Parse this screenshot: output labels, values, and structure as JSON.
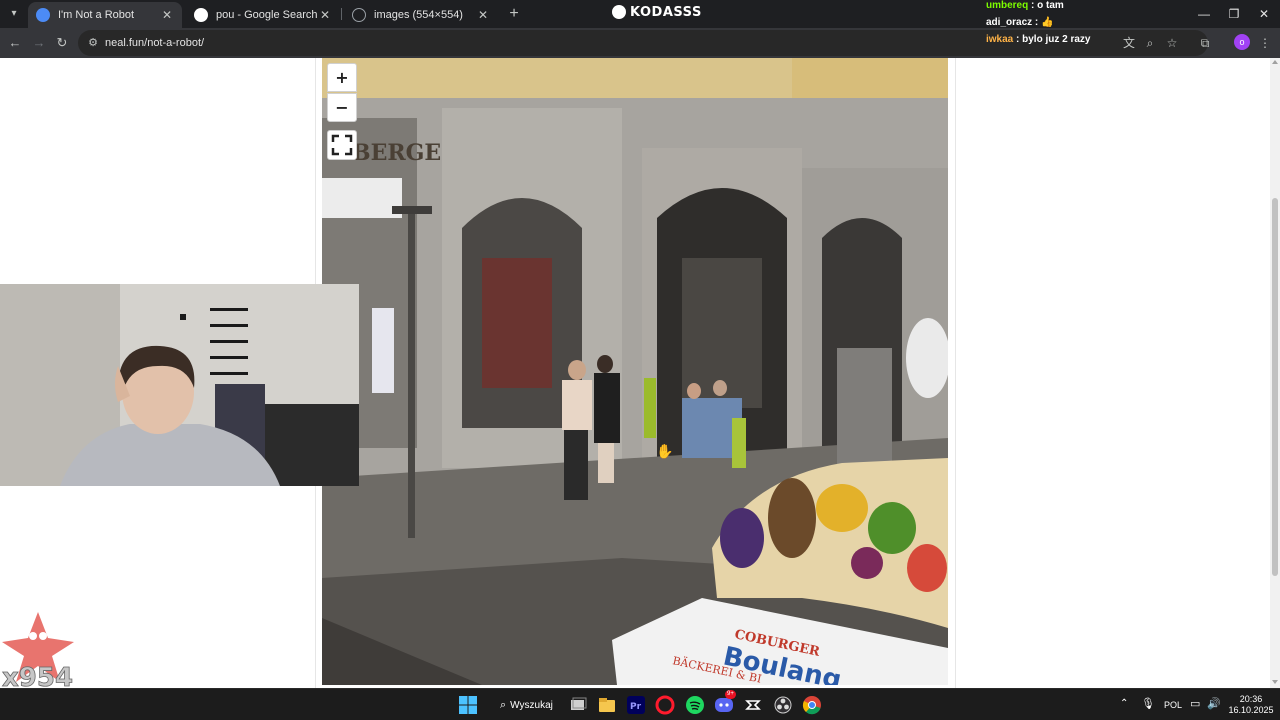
{
  "browser": {
    "tabs": [
      {
        "title": "I'm Not a Robot",
        "active": true,
        "favicon_color": "#4c8bf5"
      },
      {
        "title": "pou - Google Search",
        "active": false,
        "favicon_color": "#ffffff"
      },
      {
        "title": "images (554×554)",
        "active": false,
        "favicon_color": "#9aa0a6"
      }
    ],
    "url": "neal.fun/not-a-robot/",
    "overlay_title": "KODASSS"
  },
  "chat": [
    {
      "user": "umbereq",
      "user_color": "#7cfc00",
      "message": "o tam"
    },
    {
      "user": "adi_oracz",
      "user_color": "#ffffff",
      "message": "👍"
    },
    {
      "user": "iwkaa",
      "user_color": "#ffb347",
      "message": "bylo juz 2 razy"
    }
  ],
  "map_controls": {
    "zoom_in": "+",
    "zoom_out": "−"
  },
  "street_view": {
    "shop_sign_top": "BERGE",
    "bakery_sign_line1": "COBURGER",
    "bakery_sign_line2": "Boulang",
    "bakery_sign_line3": "BÄCKEREI & BI"
  },
  "stream_overlay": {
    "watermark": "x954"
  },
  "taskbar": {
    "search_label": "Wyszukaj",
    "language": "POL",
    "time": "20:36",
    "date": "16.10.2025",
    "discord_badge": "9+"
  }
}
